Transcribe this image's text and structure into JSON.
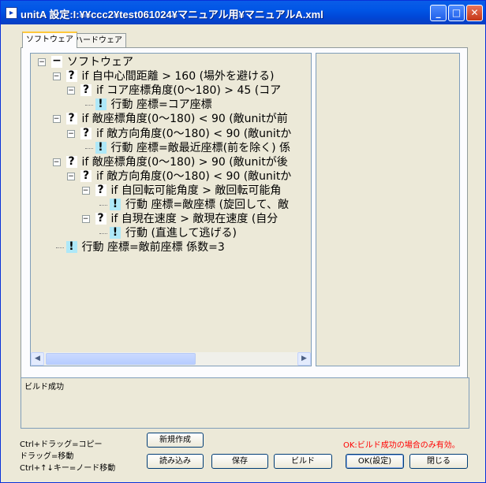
{
  "window": {
    "title": "unitA 設定:I:¥¥ccc2¥test061024¥マニュアル用¥マニュアルA.xml"
  },
  "tabs": [
    "ソフトウェア",
    "ハードウェア"
  ],
  "tree": {
    "nodes": [
      {
        "marker": "−",
        "text": "ソフトウェア"
      },
      {
        "marker": "?",
        "text": "if 自中心間距離 > 160 (場外を避ける)"
      },
      {
        "marker": "?",
        "text": "if コア座標角度(0〜180) > 45 (コア"
      },
      {
        "marker": "!",
        "text": "行動 座標=コア座標"
      },
      {
        "marker": "?",
        "text": "if 敵座標角度(0〜180) < 90 (敵unitが前"
      },
      {
        "marker": "?",
        "text": "if 敵方向角度(0〜180) < 90 (敵unitか"
      },
      {
        "marker": "!",
        "text": "行動 座標=敵最近座標(前を除く) 係"
      },
      {
        "marker": "?",
        "text": "if 敵座標角度(0〜180) > 90 (敵unitが後"
      },
      {
        "marker": "?",
        "text": "if 敵方向角度(0〜180) < 90 (敵unitか"
      },
      {
        "marker": "?",
        "text": "if 自回転可能角度 > 敵回転可能角"
      },
      {
        "marker": "!",
        "text": "行動 座標=敵座標 (旋回して、敵"
      },
      {
        "marker": "?",
        "text": "if 自現在速度 > 敵現在速度 (自分"
      },
      {
        "marker": "!",
        "text": "行動 (直進して逃げる)"
      },
      {
        "marker": "!",
        "text": "行動 座標=敵前座標 係数=3"
      }
    ]
  },
  "status": {
    "text": "ビルド成功"
  },
  "hints": [
    "Ctrl+ドラッグ=コピー",
    "ドラッグ=移動",
    "Ctrl+↑↓キー=ノード移動"
  ],
  "warning": "OK:ビルド成功の場合のみ有効。",
  "buttons": {
    "new": "新規作成",
    "load": "読み込み",
    "save": "保存",
    "build": "ビルド",
    "ok": "OK(設定)",
    "close": "閉じる"
  },
  "icons": {
    "minimize": "minimize-icon",
    "maximize": "maximize-icon",
    "close": "close-icon",
    "scroll_left": "arrow-left-icon",
    "scroll_right": "arrow-right-icon"
  },
  "colors": {
    "titlebar": "#0055e5",
    "warning": "#ff0000",
    "action_marker": "#aee8f8"
  }
}
